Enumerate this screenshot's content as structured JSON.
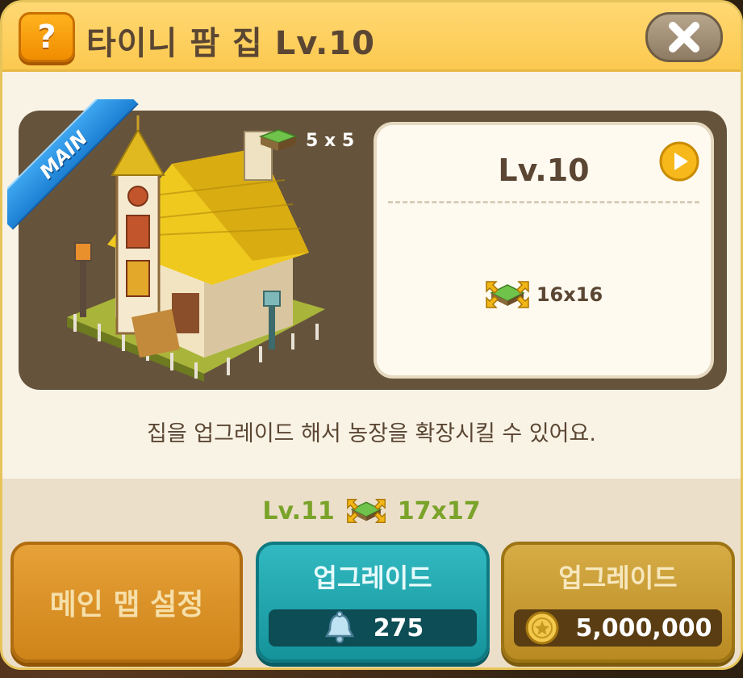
{
  "header": {
    "help_label": "?",
    "title": "타이니 팜 집 Lv.10",
    "close_icon": "close-x-icon"
  },
  "building": {
    "ribbon": "MAIN",
    "size_label": "5 x 5"
  },
  "level_card": {
    "level": "Lv.10",
    "farm_size": "16x16"
  },
  "description": "집을 업그레이드 해서 농장을 확장시킬 수 있어요.",
  "next": {
    "level": "Lv.11",
    "farm_size": "17x17"
  },
  "buttons": {
    "main_map": "메인 맵 설정",
    "upgrade_bell": {
      "label": "업그레이드",
      "cost": "275",
      "icon": "bell-icon"
    },
    "upgrade_coin": {
      "label": "업그레이드",
      "cost": "5,000,000",
      "icon": "coin-icon"
    }
  },
  "colors": {
    "header": "#fcc94f",
    "teal_button": "#15939b",
    "gold_button": "#b98a22",
    "orange_button": "#cf8419",
    "next_level_green": "#7aa32a"
  }
}
